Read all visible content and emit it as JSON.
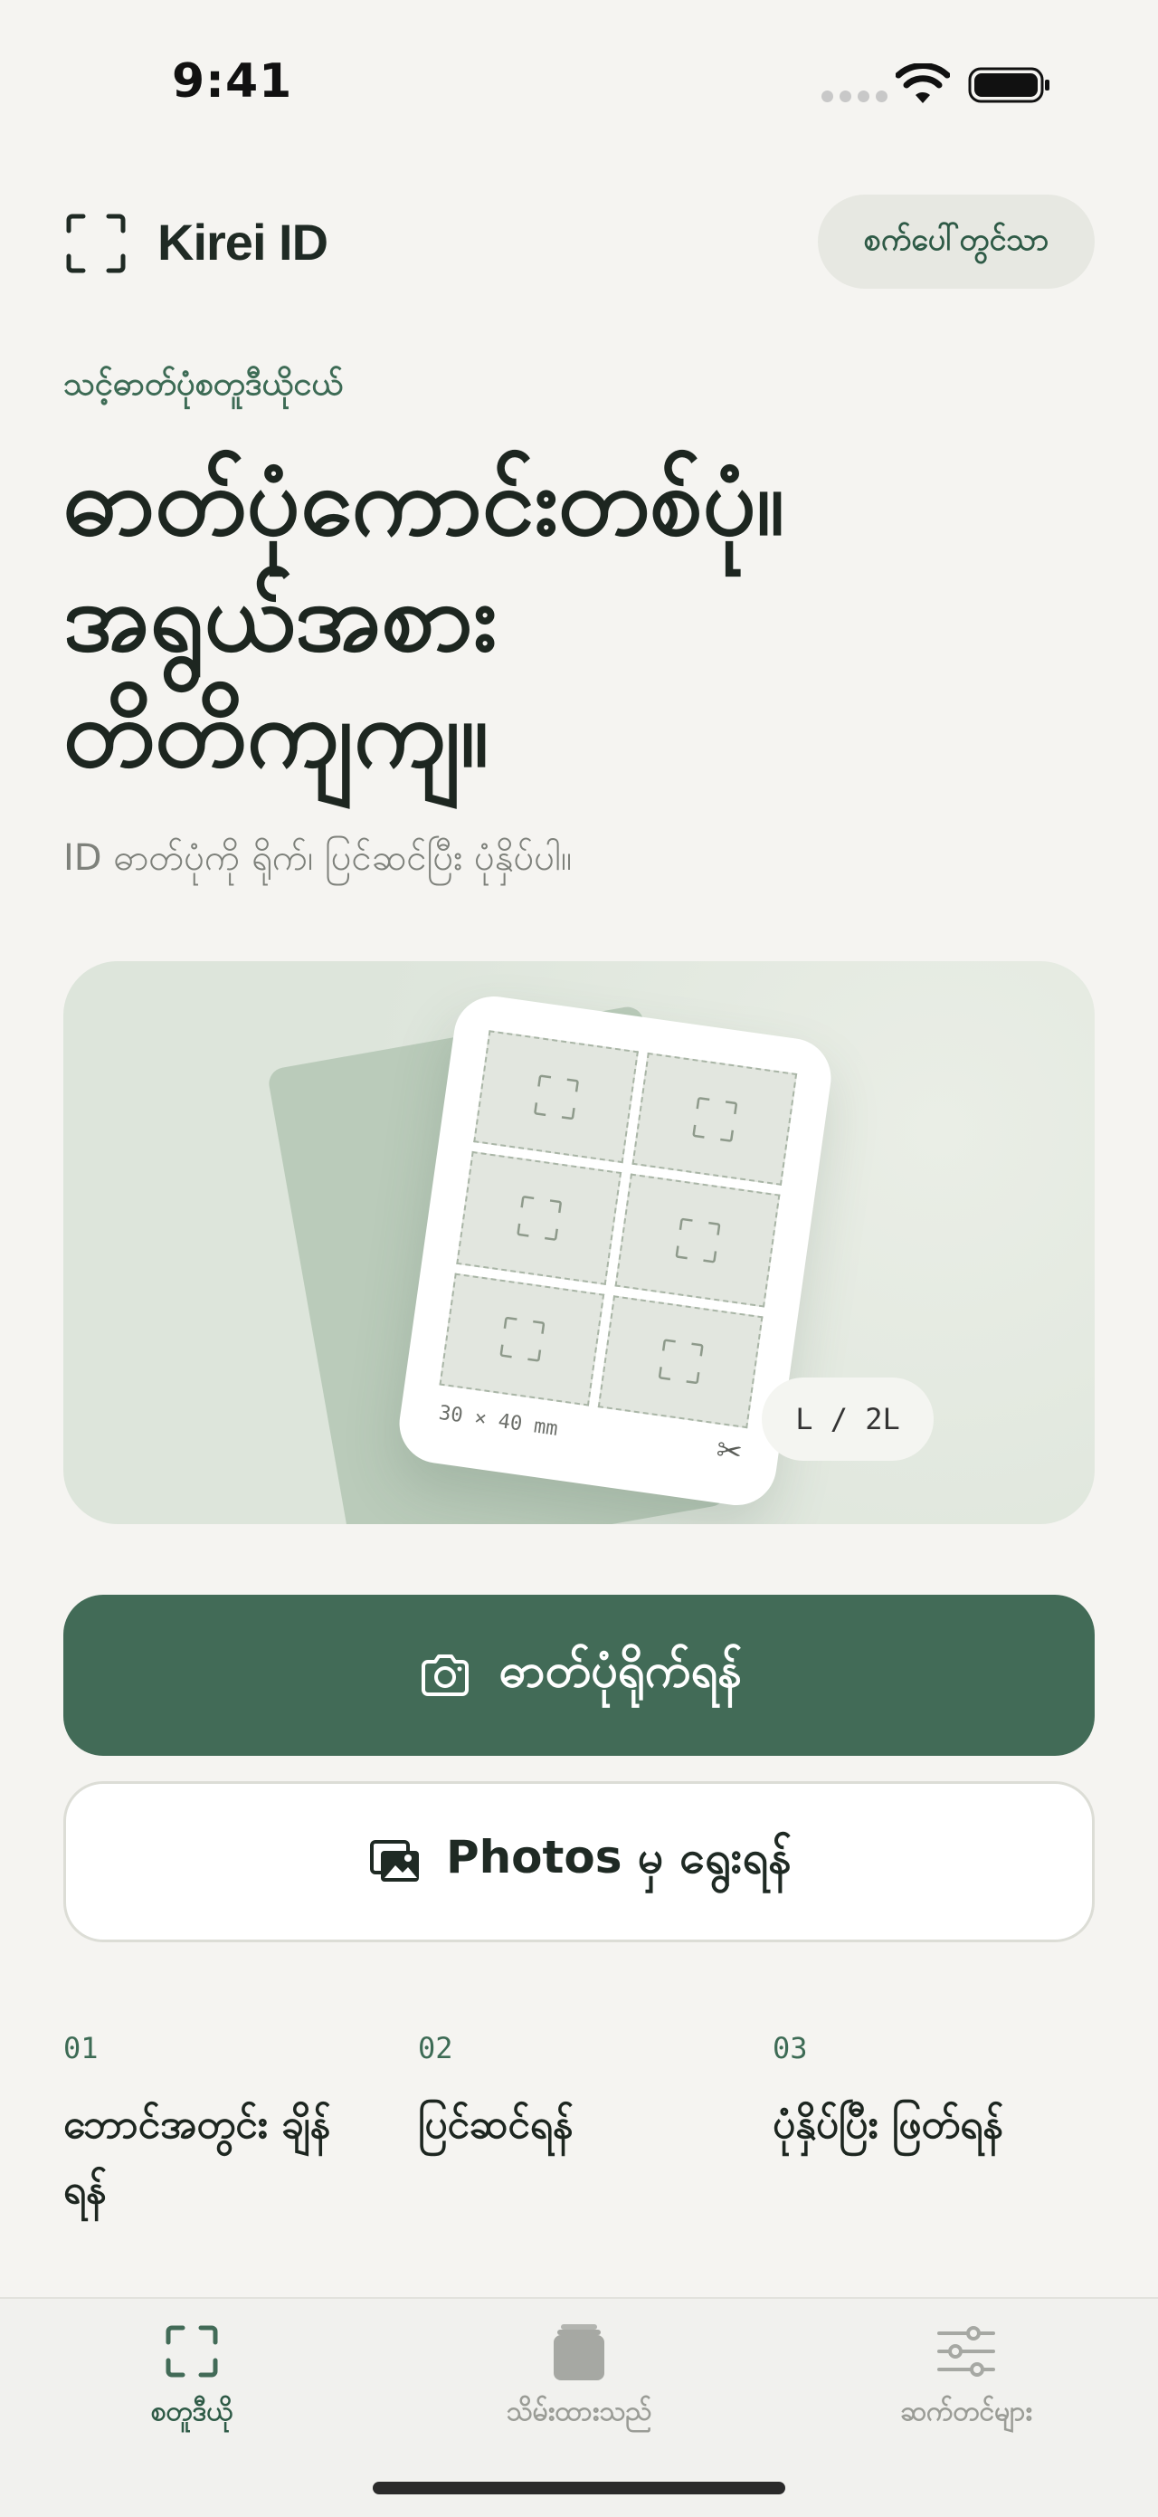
{
  "status_bar": {
    "time": "9:41",
    "icons": [
      "signal-icon",
      "wifi-icon",
      "battery-icon"
    ]
  },
  "header": {
    "app_title": "Kirei ID",
    "login_label": "စက်ပေါ်တွင်သာ",
    "logo_icon": "frame-icon"
  },
  "hero": {
    "eyebrow": "သင့်ဓာတ်ပုံစတူဒီယိုငယ်",
    "title_lines": [
      "ဓာတ်ပုံကောင်းတစ်ပုံ။",
      "အရွယ်အစား",
      "တိတိကျကျ။"
    ],
    "subtitle": "ID ဓာတ်ပုံကို ရိုက်၊ ပြင်ဆင်ပြီး ပုံနှိပ်ပါ။"
  },
  "illustration": {
    "sheet_size": "30 × 40 mm",
    "size_badge": "L / 2L",
    "scissors_icon": "scissors-icon",
    "cell_icon": "frame-icon"
  },
  "actions": {
    "primary_label": "ဓာတ်ပုံရိုက်ရန်",
    "primary_icon": "camera-icon",
    "secondary_label": "Photos မှ ရွေးရန်",
    "secondary_icon": "photos-icon"
  },
  "steps": [
    {
      "number": "01",
      "label": "ဘောင်အတွင်း ချိန်ရန်"
    },
    {
      "number": "02",
      "label": "ပြင်ဆင်ရန်"
    },
    {
      "number": "03",
      "label": "ပုံနှိပ်ပြီး ဖြတ်ရန်"
    }
  ],
  "tab_bar": {
    "tabs": [
      {
        "label": "စတူဒီယို",
        "icon": "frame-icon",
        "active": true
      },
      {
        "label": "သိမ်းထားသည်",
        "icon": "stack-icon",
        "active": false
      },
      {
        "label": "ဆက်တင်များ",
        "icon": "sliders-icon",
        "active": false
      }
    ]
  },
  "colors": {
    "accent": "#426b57",
    "background": "#f5f4f1",
    "accent_text": "#2e5a46"
  }
}
